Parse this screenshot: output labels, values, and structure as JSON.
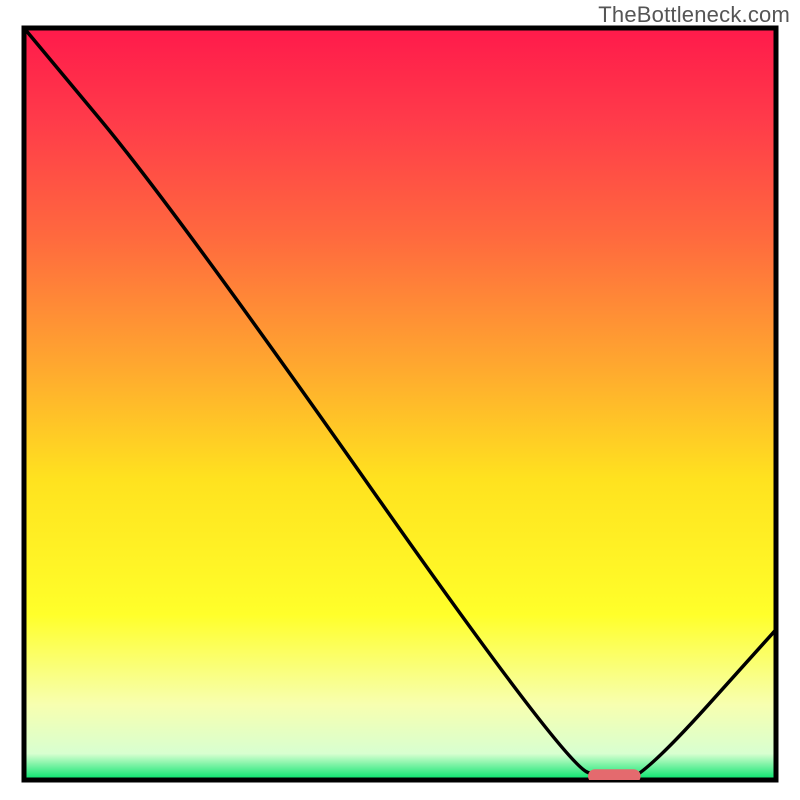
{
  "watermark": "TheBottleneck.com",
  "chart_data": {
    "type": "line",
    "title": "",
    "xlabel": "",
    "ylabel": "",
    "xlim": [
      0,
      100
    ],
    "ylim": [
      0,
      100
    ],
    "grid": false,
    "series": [
      {
        "name": "curve",
        "x": [
          0,
          20,
          72,
          78,
          82,
          100
        ],
        "values": [
          100,
          76,
          2,
          0,
          0,
          20
        ]
      }
    ],
    "marker": {
      "x_start": 75,
      "x_end": 82,
      "y": 0.5,
      "color": "#e46a6e"
    },
    "gradient_stops": [
      {
        "offset": 0,
        "color": "#ff1a4b"
      },
      {
        "offset": 0.12,
        "color": "#ff3a4a"
      },
      {
        "offset": 0.28,
        "color": "#ff6a3e"
      },
      {
        "offset": 0.45,
        "color": "#ffa82f"
      },
      {
        "offset": 0.6,
        "color": "#ffe21f"
      },
      {
        "offset": 0.78,
        "color": "#ffff2a"
      },
      {
        "offset": 0.9,
        "color": "#f7ffb0"
      },
      {
        "offset": 0.965,
        "color": "#d8ffd0"
      },
      {
        "offset": 1.0,
        "color": "#00e36b"
      }
    ]
  }
}
